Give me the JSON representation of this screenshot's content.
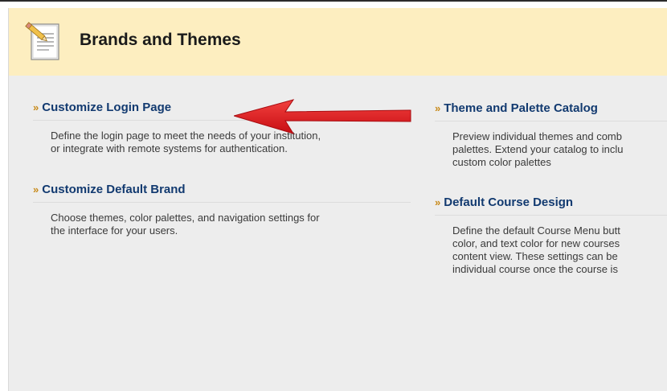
{
  "header": {
    "title": "Brands and Themes",
    "icon": "document-pencil-icon"
  },
  "left_column": [
    {
      "link": "Customize Login Page",
      "description": [
        "Define the login page to meet the needs of your institution,",
        "or integrate with remote systems for authentication."
      ]
    },
    {
      "link": "Customize Default Brand",
      "description": [
        "Choose themes, color palettes, and navigation settings for",
        "the interface for your users."
      ]
    }
  ],
  "right_column": [
    {
      "link": "Theme and Palette Catalog",
      "description": [
        "Preview individual themes and comb",
        "palettes. Extend your catalog to inclu",
        "custom color palettes"
      ]
    },
    {
      "link": "Default Course Design",
      "description": [
        "Define the default Course Menu butt",
        "color, and text color for new courses",
        "content view. These settings can be",
        "individual course once the course is"
      ]
    }
  ],
  "chevron": "»",
  "colors": {
    "header_bg": "#fdeec0",
    "panel_bg": "#ededed",
    "link": "#123a70",
    "chevron": "#c88a1a",
    "arrow": "#e3141a"
  }
}
